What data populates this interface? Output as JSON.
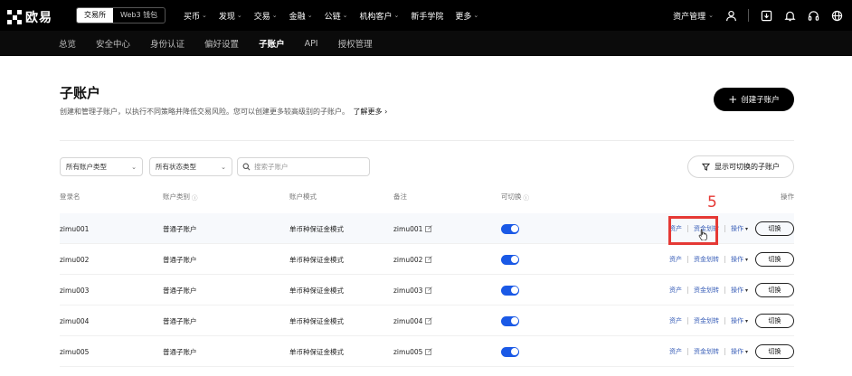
{
  "brand": {
    "name": "欧易"
  },
  "mode_switch": {
    "exchange": "交易所",
    "wallet": "Web3 钱包"
  },
  "nav": {
    "items": [
      {
        "label": "买币",
        "dropdown": true
      },
      {
        "label": "发现",
        "dropdown": true
      },
      {
        "label": "交易",
        "dropdown": true
      },
      {
        "label": "金融",
        "dropdown": true
      },
      {
        "label": "公链",
        "dropdown": true
      },
      {
        "label": "机构客户",
        "dropdown": true
      },
      {
        "label": "新手学院",
        "dropdown": false
      },
      {
        "label": "更多",
        "dropdown": true
      }
    ],
    "asset_management": "资产管理",
    "icons": [
      "user-icon",
      "download-icon",
      "bell-icon",
      "headset-icon",
      "globe-icon"
    ]
  },
  "subnav": {
    "items": [
      "总览",
      "安全中心",
      "身份认证",
      "偏好设置",
      "子账户",
      "API",
      "授权管理"
    ],
    "active_index": 4
  },
  "header": {
    "title": "子账户",
    "description": "创建和管理子账户，以执行不同策略并降低交易风险。您可以创建更多较高级别的子账户。",
    "learn_more": "了解更多",
    "create_button": "创建子账户"
  },
  "filters": {
    "account_type": "所有账户类型",
    "status_type": "所有状态类型",
    "search_placeholder": "搜索子账户",
    "show_switchable": "显示可切换的子账户"
  },
  "table": {
    "headers": [
      "登录名",
      "账户类别",
      "账户模式",
      "备注",
      "可切换",
      "操作"
    ],
    "rows": [
      {
        "login": "zimu001",
        "category": "普通子账户",
        "mode": "单币种保证金模式",
        "note": "zimu001",
        "switchable": true
      },
      {
        "login": "zimu002",
        "category": "普通子账户",
        "mode": "单币种保证金模式",
        "note": "zimu002",
        "switchable": true
      },
      {
        "login": "zimu003",
        "category": "普通子账户",
        "mode": "单币种保证金模式",
        "note": "zimu003",
        "switchable": true
      },
      {
        "login": "zimu004",
        "category": "普通子账户",
        "mode": "单币种保证金模式",
        "note": "zimu004",
        "switchable": true
      },
      {
        "login": "zimu005",
        "category": "普通子账户",
        "mode": "单币种保证金模式",
        "note": "zimu005",
        "switchable": true
      }
    ],
    "actions": {
      "assets": "资产",
      "transfer": "资金划转",
      "operate": "操作",
      "switch": "切换"
    }
  },
  "annotation": {
    "step": "5",
    "color": "#e53935"
  },
  "colors": {
    "toggle_on": "#1a59e6",
    "link": "#3a5fb8",
    "nav_bg": "#000000"
  }
}
